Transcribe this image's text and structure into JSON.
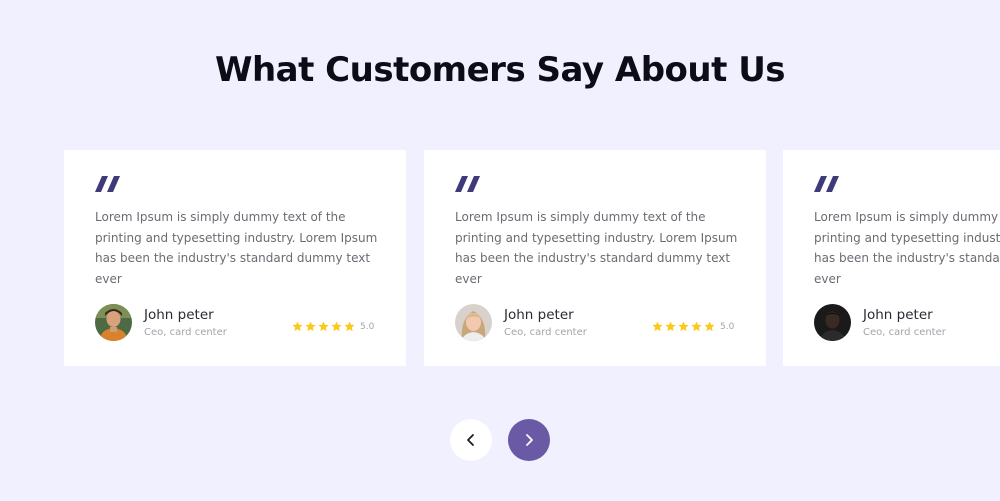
{
  "section": {
    "title": "What Customers Say About Us"
  },
  "colors": {
    "background": "#f1f0ff",
    "card": "#ffffff",
    "accent": "#3f3a7a",
    "star": "#fbc91a",
    "nav_active": "#6a5aa6"
  },
  "testimonials": [
    {
      "quote_icon": "quote-icon",
      "text": "Lorem Ipsum is simply dummy text of the printing and typesetting industry. Lorem Ipsum has been the industry's standard dummy text ever",
      "name": "John peter",
      "role": "Ceo, card center",
      "rating": 5,
      "rating_label": "5.0"
    },
    {
      "quote_icon": "quote-icon",
      "text": "Lorem Ipsum is simply dummy text of the printing and typesetting industry. Lorem Ipsum has been the industry's standard dummy text ever",
      "name": "John peter",
      "role": "Ceo, card center",
      "rating": 5,
      "rating_label": "5.0"
    },
    {
      "quote_icon": "quote-icon",
      "text": "Lorem Ipsum is simply dummy text of the printing and typesetting industry. Lorem Ipsum has been the industry's standard dummy text ever",
      "name": "John peter",
      "role": "Ceo, card center",
      "rating": null,
      "rating_label": null
    }
  ],
  "navigation": {
    "prev_icon": "chevron-left-icon",
    "next_icon": "chevron-right-icon"
  }
}
